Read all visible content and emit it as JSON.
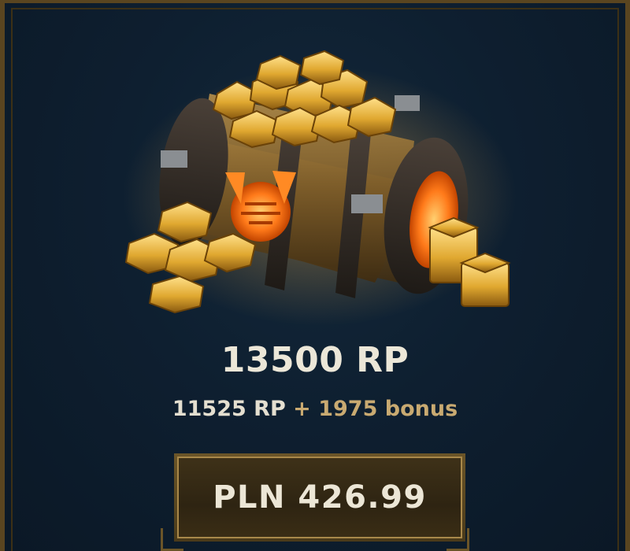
{
  "product": {
    "total": "13500 RP",
    "base": "11525 RP",
    "plus": " + ",
    "bonus": "1975 bonus",
    "image": "rp-chest-icon"
  },
  "buy_button": {
    "label": "PLN 426.99"
  },
  "colors": {
    "background": "#0e1f30",
    "frame_gold": "#5a4520",
    "bonus_gold": "#c9aa71",
    "text": "#ece7d8"
  }
}
